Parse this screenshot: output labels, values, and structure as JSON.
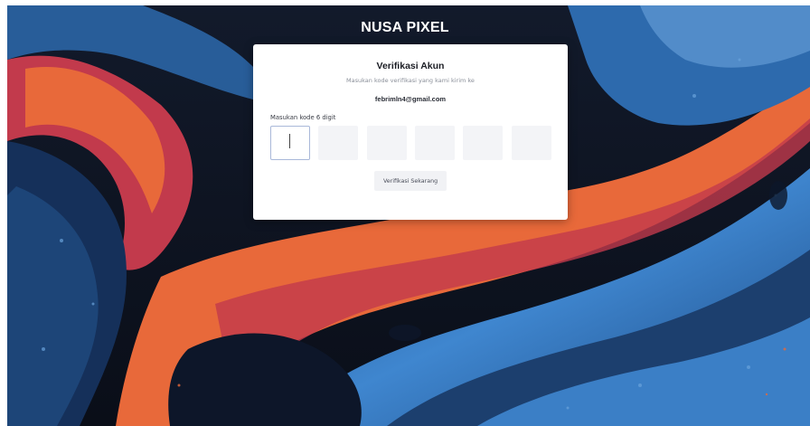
{
  "brand": {
    "name": "NUSA PIXEL"
  },
  "card": {
    "title": "Verifikasi Akun",
    "subtitle": "Masukan kode verifikasi yang kami kirim ke",
    "email": "febrimln4@gmail.com",
    "code_label": "Masukan kode 6 digit",
    "digits": [
      "",
      "",
      "",
      "",
      "",
      ""
    ],
    "button_label": "Verifikasi Sekarang"
  },
  "colors": {
    "card_bg": "#ffffff",
    "input_bg": "#f3f4f7",
    "active_border": "#a9b8d9",
    "background_dark": "#0b0f1a",
    "swirl_orange": "#e8693a",
    "swirl_red": "#c23a4c",
    "swirl_blue": "#3f86cf"
  }
}
